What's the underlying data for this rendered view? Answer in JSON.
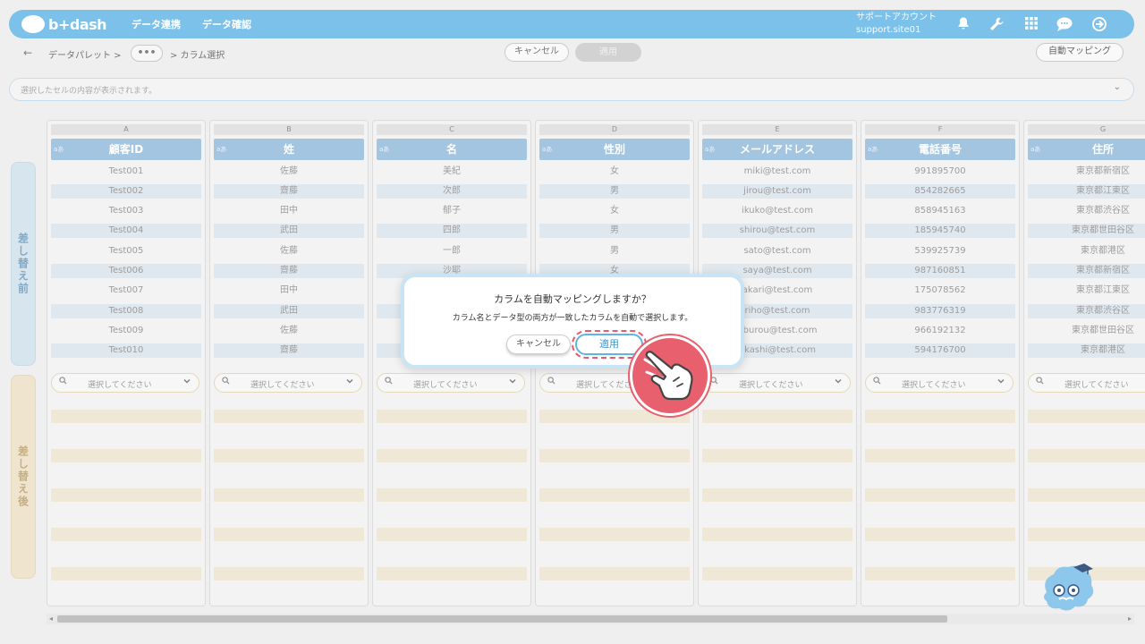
{
  "header": {
    "logo": "b+dash",
    "nav": [
      "データ連携",
      "データ確認"
    ],
    "account_line1": "サポートアカウント",
    "account_line2": "support.site01",
    "icons": [
      "bell-icon",
      "wrench-icon",
      "grid-icon",
      "chat-icon",
      "logout-icon"
    ]
  },
  "toolbar": {
    "back": "←",
    "breadcrumb_first": "データパレット >",
    "ellipsis": "•••",
    "breadcrumb_last": "> カラム選択",
    "cancel": "キャンセル",
    "apply": "適用",
    "auto_mapping": "自動マッピング"
  },
  "cellbar": {
    "placeholder": "選択したセルの内容が表示されます。",
    "chevron": "⌄"
  },
  "sides": {
    "before": "差し替え前",
    "after": "差し替え後"
  },
  "type_tag": "aあ",
  "select_placeholder": "選択してください",
  "columns": [
    {
      "letter": "A",
      "name": "顧客ID",
      "rows": [
        "Test001",
        "Test002",
        "Test003",
        "Test004",
        "Test005",
        "Test006",
        "Test007",
        "Test008",
        "Test009",
        "Test010"
      ]
    },
    {
      "letter": "B",
      "name": "姓",
      "rows": [
        "佐藤",
        "齋藤",
        "田中",
        "武田",
        "佐藤",
        "齋藤",
        "田中",
        "武田",
        "佐藤",
        "齋藤"
      ]
    },
    {
      "letter": "C",
      "name": "名",
      "rows": [
        "美紀",
        "次郎",
        "郁子",
        "四郎",
        "一郎",
        "沙耶",
        "",
        "",
        "",
        ""
      ]
    },
    {
      "letter": "D",
      "name": "性別",
      "rows": [
        "女",
        "男",
        "女",
        "男",
        "男",
        "女",
        "",
        "",
        "",
        ""
      ]
    },
    {
      "letter": "E",
      "name": "メールアドレス",
      "rows": [
        "miki@test.com",
        "jirou@test.com",
        "ikuko@test.com",
        "shirou@test.com",
        "sato@test.com",
        "saya@test.com",
        "akari@test.com",
        "riho@test.com",
        "aburou@test.com",
        "akashi@test.com"
      ]
    },
    {
      "letter": "F",
      "name": "電話番号",
      "rows": [
        "991895700",
        "854282665",
        "858945163",
        "185945740",
        "539925739",
        "987160851",
        "175078562",
        "983776319",
        "966192132",
        "594176700"
      ]
    },
    {
      "letter": "G",
      "name": "住所",
      "rows": [
        "東京都新宿区",
        "東京都江東区",
        "東京都渋谷区",
        "東京都世田谷区",
        "東京都港区",
        "東京都新宿区",
        "東京都江東区",
        "東京都渋谷区",
        "東京都世田谷区",
        "東京都港区"
      ]
    }
  ],
  "dialog": {
    "title": "カラムを自動マッピングしますか？",
    "message": "カラム名とデータ型の両方が一致したカラムを自動で選択します。",
    "cancel": "キャンセル",
    "apply": "適用"
  },
  "colors": {
    "brand": "#5fb4e6",
    "header_cell": "#8fb9da",
    "pointer": "#e8606e"
  }
}
